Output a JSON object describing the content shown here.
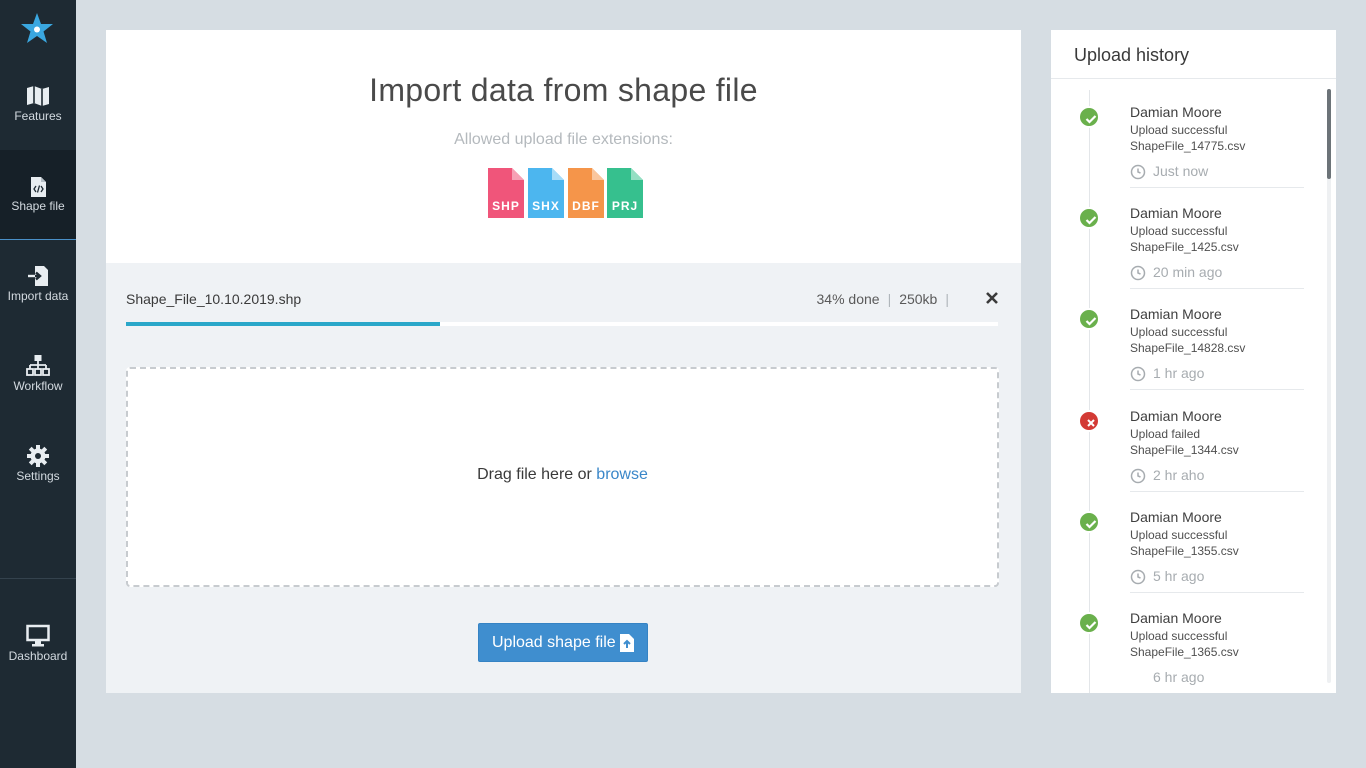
{
  "sidebar": {
    "items": [
      {
        "label": "Features",
        "icon": "map-icon"
      },
      {
        "label": "Shape file",
        "icon": "file-code-icon"
      },
      {
        "label": "Import data",
        "icon": "import-icon"
      },
      {
        "label": "Workflow",
        "icon": "sitemap-icon"
      },
      {
        "label": "Settings",
        "icon": "gear-icon"
      },
      {
        "label": "Dashboard",
        "icon": "monitor-icon"
      }
    ],
    "active": "Shape file"
  },
  "main": {
    "title": "Import data from shape file",
    "subtitle": "Allowed upload file extensions:",
    "extensions": [
      {
        "label": "SHP",
        "color": "#f0557a"
      },
      {
        "label": "SHX",
        "color": "#4cb6ef"
      },
      {
        "label": "DBF",
        "color": "#f5954a"
      },
      {
        "label": "PRJ",
        "color": "#36c08e"
      }
    ],
    "upload": {
      "file_name": "Shape_File_10.10.2019.shp",
      "progress_text": "34% done",
      "progress": 0.36,
      "size": "250kb",
      "sep": "|"
    },
    "dropzone": {
      "text": "Drag file here or ",
      "link": "browse"
    },
    "upload_button": "Upload shape file"
  },
  "history": {
    "title": "Upload history",
    "items": [
      {
        "name": "Damian Moore",
        "status": "Upload successful",
        "file": "ShapeFile_14775.csv",
        "time": "Just now",
        "result": "success"
      },
      {
        "name": "Damian Moore",
        "status": "Upload successful",
        "file": "ShapeFile_1425.csv",
        "time": "20 min ago",
        "result": "success"
      },
      {
        "name": "Damian Moore",
        "status": "Upload successful",
        "file": "ShapeFile_14828.csv",
        "time": "1 hr ago",
        "result": "success"
      },
      {
        "name": "Damian Moore",
        "status": "Upload failed",
        "file": "ShapeFile_1344.csv",
        "time": "2 hr aho",
        "result": "failed"
      },
      {
        "name": "Damian Moore",
        "status": "Upload successful",
        "file": "ShapeFile_1355.csv",
        "time": "5 hr ago",
        "result": "success"
      },
      {
        "name": "Damian Moore",
        "status": "Upload successful",
        "file": "ShapeFile_1365.csv",
        "time": "6 hr ago",
        "result": "success"
      }
    ]
  },
  "colors": {
    "sidebar": "#1e2a33",
    "accent": "#3f8ecf",
    "progress": "#2aa7c9",
    "success": "#6ab04c",
    "failed": "#d33a35"
  }
}
